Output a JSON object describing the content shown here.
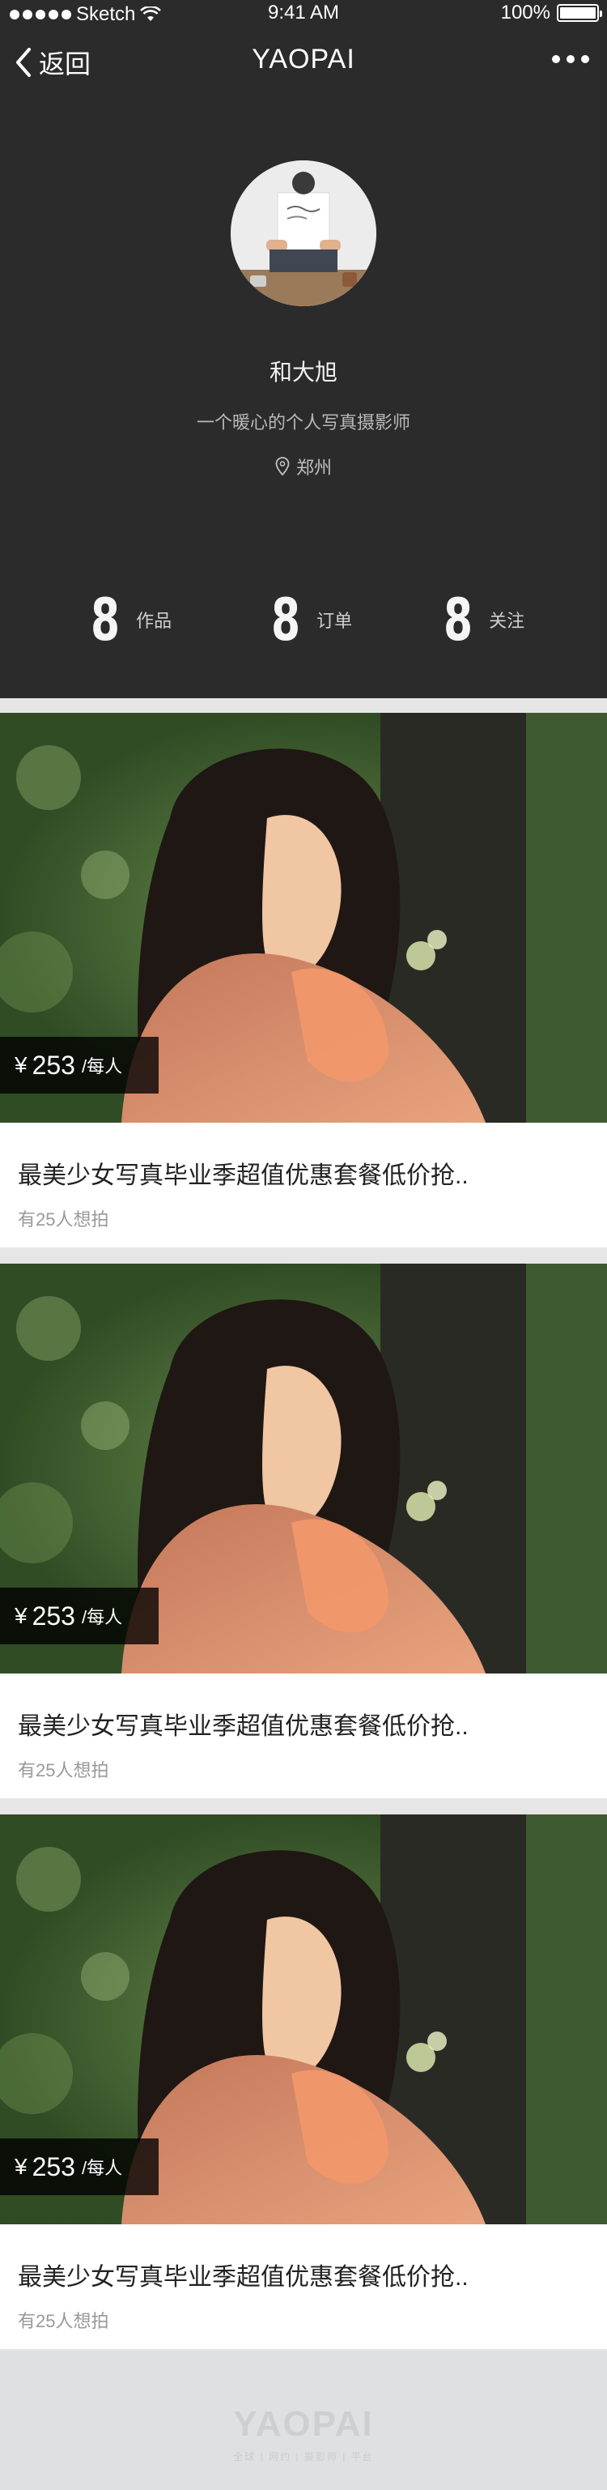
{
  "status_bar": {
    "carrier": "Sketch",
    "time": "9:41 AM",
    "battery": "100%"
  },
  "nav": {
    "back_label": "返回",
    "title": "YAOPAI"
  },
  "profile": {
    "name": "和大旭",
    "bio": "一个暖心的个人写真摄影师",
    "location": "郑州"
  },
  "stats": [
    {
      "value": "8",
      "label": "作品"
    },
    {
      "value": "8",
      "label": "订单"
    },
    {
      "value": "8",
      "label": "关注"
    }
  ],
  "cards": [
    {
      "currency": "¥",
      "price": "253",
      "unit": "/每人",
      "title": "最美少女写真毕业季超值优惠套餐低价抢..",
      "subtitle": "有25人想拍"
    },
    {
      "currency": "¥",
      "price": "253",
      "unit": "/每人",
      "title": "最美少女写真毕业季超值优惠套餐低价抢..",
      "subtitle": "有25人想拍"
    },
    {
      "currency": "¥",
      "price": "253",
      "unit": "/每人",
      "title": "最美少女写真毕业季超值优惠套餐低价抢..",
      "subtitle": "有25人想拍"
    }
  ],
  "footer": {
    "logo": "YAOPAI",
    "tagline": "全球 | 网约 | 摄影师 | 平台"
  },
  "colors": {
    "header_bg": "#2b2b2b",
    "page_bg": "#e6e6e6",
    "price_tag_bg": "#000000"
  }
}
